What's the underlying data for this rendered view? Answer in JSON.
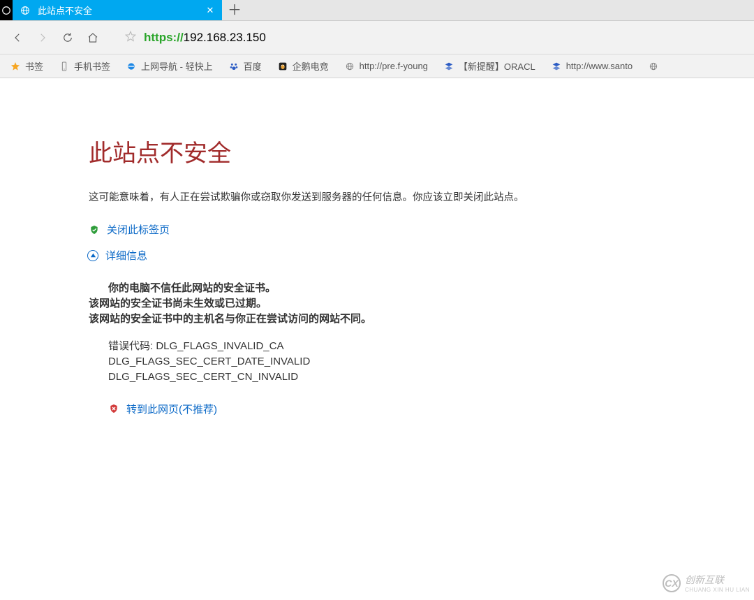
{
  "tab": {
    "title": "此站点不安全"
  },
  "address": {
    "scheme": "https:",
    "sep": "//",
    "host": "192.168.23.150"
  },
  "bookmarks": [
    {
      "label": "书签",
      "icon": "star-filled",
      "color": "#f6a623"
    },
    {
      "label": "手机书签",
      "icon": "phone",
      "color": "#888"
    },
    {
      "label": "上网导航 - 轻快上",
      "icon": "ie",
      "color": "#1e88e5"
    },
    {
      "label": "百度",
      "icon": "paw",
      "color": "#2b5cc4"
    },
    {
      "label": "企鹅电竞",
      "icon": "penguin",
      "color": "#e8a33a"
    },
    {
      "label": "http://pre.f-young",
      "icon": "globe",
      "color": "#888"
    },
    {
      "label": "【新提醒】ORACL",
      "icon": "stack",
      "color": "#2b5cc4"
    },
    {
      "label": "http://www.santo",
      "icon": "stack",
      "color": "#2b5cc4"
    },
    {
      "label": "",
      "icon": "globe",
      "color": "#888"
    }
  ],
  "page": {
    "title": "此站点不安全",
    "desc": "这可能意味着，有人正在尝试欺骗你或窃取你发送到服务器的任何信息。你应该立即关闭此站点。",
    "close_tab": "关闭此标签页",
    "details": "详细信息",
    "det_line1": "你的电脑不信任此网站的安全证书。",
    "det_line2": "该网站的安全证书尚未生效或已过期。",
    "det_line3": "该网站的安全证书中的主机名与你正在尝试访问的网站不同。",
    "err_label": "错误代码: ",
    "err1": "DLG_FLAGS_INVALID_CA",
    "err2": "DLG_FLAGS_SEC_CERT_DATE_INVALID",
    "err3": "DLG_FLAGS_SEC_CERT_CN_INVALID",
    "proceed": "转到此网页(不推荐)"
  },
  "watermark": {
    "initials": "CX",
    "label": "创新互联",
    "sub": "CHUANG XIN HU LIAN"
  }
}
